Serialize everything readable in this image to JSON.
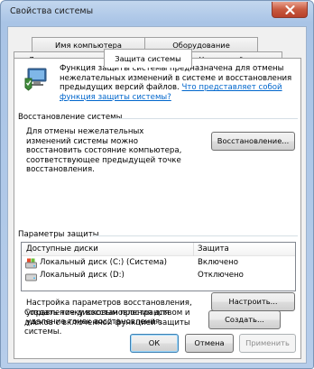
{
  "window": {
    "title": "Свойства системы"
  },
  "tabs_back": [
    "Имя компьютера",
    "Оборудование"
  ],
  "tabs_front": [
    "Дополнительно",
    "Защита системы",
    "Удаленный доступ"
  ],
  "intro": {
    "text": "Функция защиты системы предназначена для отмены нежелательных изменений в системе и восстановления предыдущих версий файлов.",
    "link": "Что представляет собой функция защиты системы?"
  },
  "restore": {
    "title": "Восстановление системы",
    "text": "Для отмены нежелательных изменений системы можно восстановить состояние компьютера, соответствующее предыдущей точке восстановления.",
    "button": "Восстановление..."
  },
  "protection": {
    "title": "Параметры защиты",
    "columns": [
      "Доступные диски",
      "Защита"
    ],
    "rows": [
      {
        "name": "Локальный диск (C:) (Система)",
        "status": "Включено",
        "icon": "system-drive-icon"
      },
      {
        "name": "Локальный диск (D:)",
        "status": "Отключено",
        "icon": "drive-icon"
      }
    ]
  },
  "configure": {
    "text": "Настройка параметров восстановления, управление дисковым пространством и удаление точек восстановления.",
    "button": "Настроить..."
  },
  "create": {
    "text": "Создать точку восстановления для дисков с включенной функцией защиты системы.",
    "button": "Создать..."
  },
  "footer": {
    "ok": "ОК",
    "cancel": "Отмена",
    "apply": "Применить"
  }
}
